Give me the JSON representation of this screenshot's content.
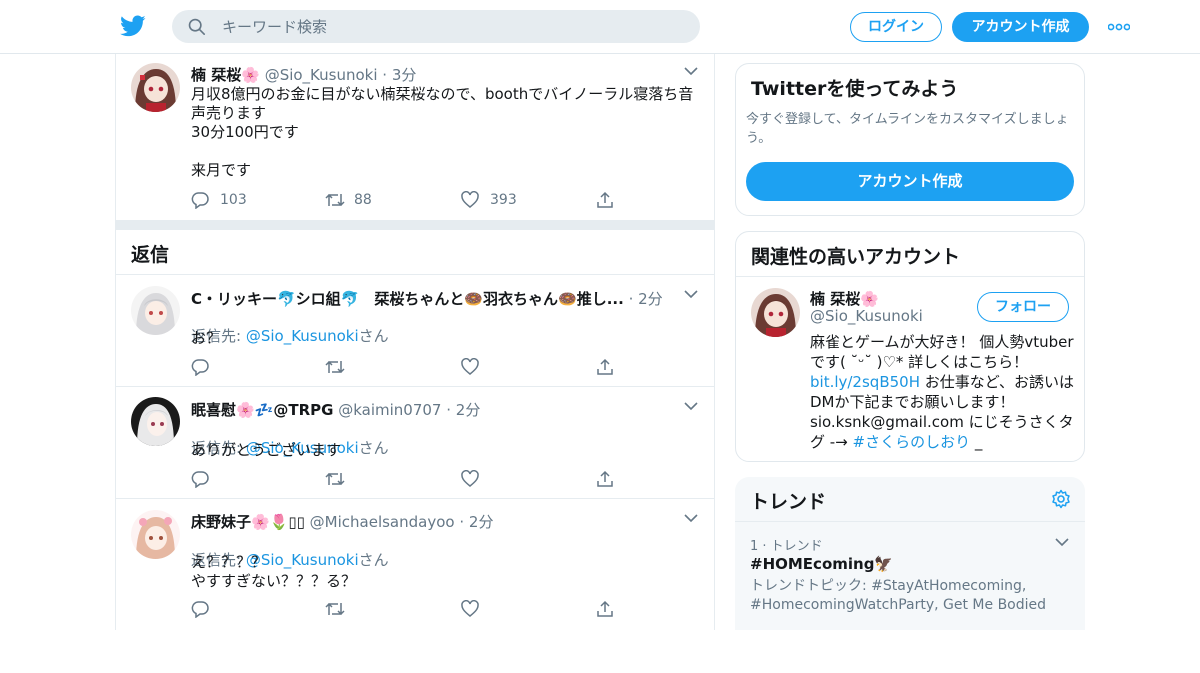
{
  "header": {
    "search_placeholder": "キーワード検索",
    "login_label": "ログイン",
    "signup_label": "アカウント作成"
  },
  "main_tweet": {
    "name": "楠 栞桜🌸",
    "handle": "@Sio_Kusunoki",
    "time": "· 3分",
    "text": "月収8億円のお金に目がない楠栞桜なので、boothでバイノーラル寝落ち音声売ります\n30分100円です\n\n来月です",
    "replies": "103",
    "retweets": "88",
    "likes": "393"
  },
  "replies_section": {
    "title": "返信",
    "reply_prefix": "返信先: ",
    "reply_suffix": "さん",
    "items": [
      {
        "name": "C・リッキー🐬シロ組🐬　栞桜ちゃんと🍩羽衣ちゃん🍩推し...",
        "handle": "",
        "time": "· 2分",
        "reply_to": "@Sio_Kusunoki",
        "text": "お？"
      },
      {
        "name": "眠喜慰🌸💤@TRPG",
        "handle": "@kaimin0707",
        "time": "· 2分",
        "reply_to": "@Sio_Kusunoki",
        "text": "ありがとうございます"
      },
      {
        "name": "床野妹子🌸🌷▯▯",
        "handle": "@Michaelsandayoo",
        "time": "· 2分",
        "reply_to": "@Sio_Kusunoki",
        "text": "え？？？？\nやすすぎない？？？る？"
      }
    ]
  },
  "signup_card": {
    "title": "Twitterを使ってみよう",
    "subtitle": "今すぐ登録して、タイムラインをカスタマイズしましょう。",
    "button": "アカウント作成"
  },
  "related_card": {
    "title": "関連性の高いアカウント",
    "name": "楠 栞桜🌸",
    "handle": "@Sio_Kusunoki",
    "follow_label": "フォロー",
    "bio_1": "麻雀とゲームが大好き！ 個人勢vtuberです( ˘ᵕ˘ )♡* 詳しくはこちら！ ",
    "bio_link": "bit.ly/2sqB50H",
    "bio_2": " お仕事など、お誘いはDMか下記までお願いします！ sio.ksnk@gmail.com にじそうさくタグ -→ ",
    "bio_hashtag": "#さくらのしおり",
    "bio_3": " _"
  },
  "trends": {
    "title": "トレンド",
    "items": [
      {
        "rank": "1 · トレンド",
        "name": "#HOMEcoming🦅",
        "topics": "トレンドトピック: #StayAtHomecoming, #HomecomingWatchParty, Get Me Bodied"
      }
    ]
  },
  "colors": {
    "accent": "#1da1f2",
    "link": "#1b95e0",
    "secondary_text": "#657786"
  }
}
